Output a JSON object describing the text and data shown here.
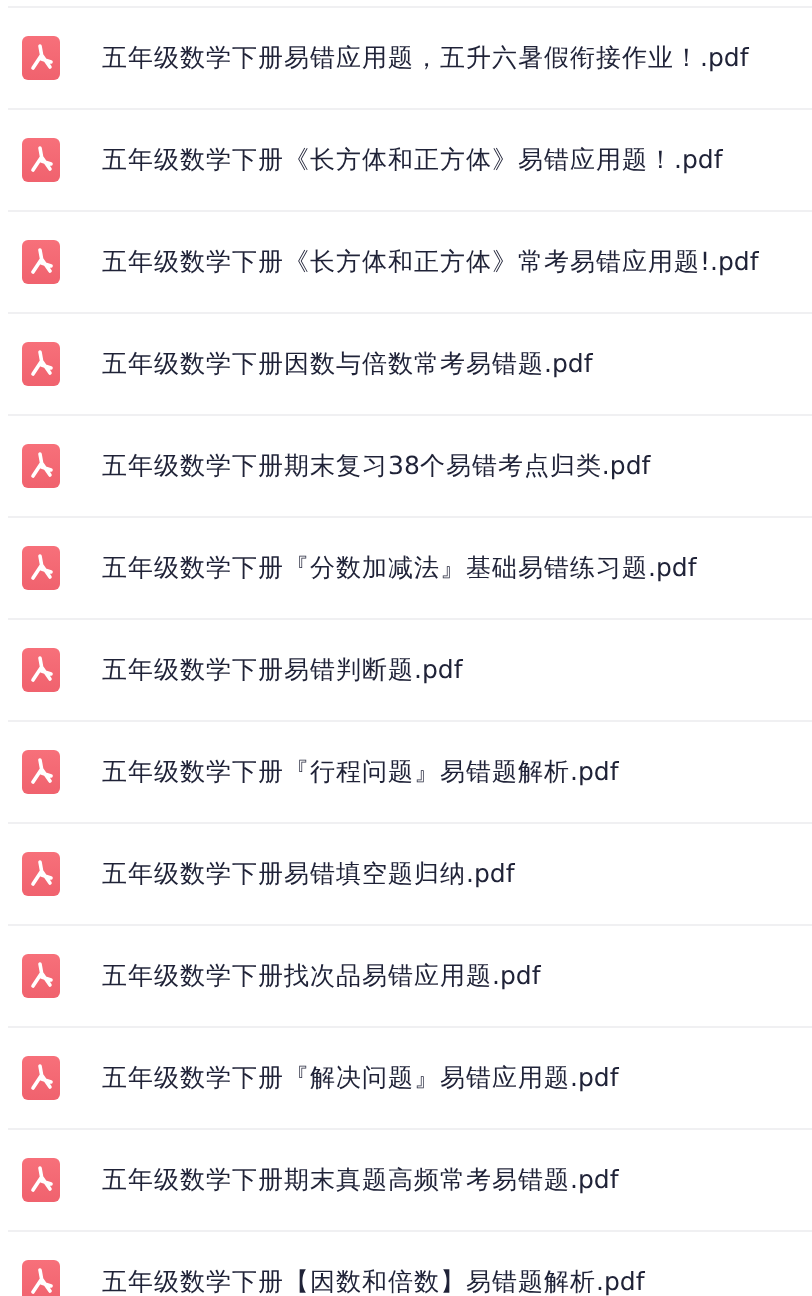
{
  "files": [
    {
      "name": "五年级数学下册易错应用题，五升六暑假衔接作业！.pdf"
    },
    {
      "name": "五年级数学下册《长方体和正方体》易错应用题！.pdf"
    },
    {
      "name": "五年级数学下册《长方体和正方体》常考易错应用题!.pdf"
    },
    {
      "name": "五年级数学下册因数与倍数常考易错题.pdf"
    },
    {
      "name": "五年级数学下册期末复习38个易错考点归类.pdf"
    },
    {
      "name": "五年级数学下册『分数加减法』基础易错练习题.pdf"
    },
    {
      "name": "五年级数学下册易错判断题.pdf"
    },
    {
      "name": "五年级数学下册『行程问题』易错题解析.pdf"
    },
    {
      "name": "五年级数学下册易错填空题归纳.pdf"
    },
    {
      "name": "五年级数学下册找次品易错应用题.pdf"
    },
    {
      "name": "五年级数学下册『解决问题』易错应用题.pdf"
    },
    {
      "name": "五年级数学下册期末真题高频常考易错题.pdf"
    },
    {
      "name": "五年级数学下册【因数和倍数】易错题解析.pdf"
    }
  ]
}
